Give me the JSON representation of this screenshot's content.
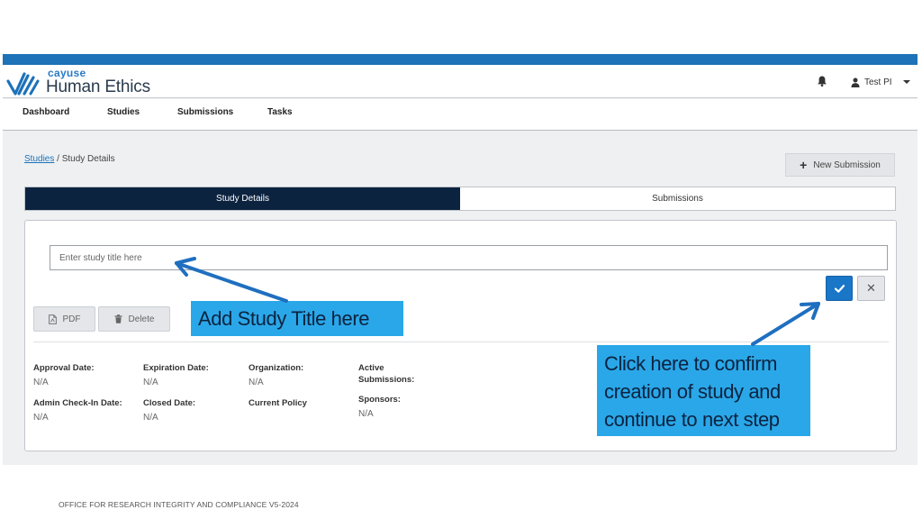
{
  "header": {
    "logo_small": "cayuse",
    "logo_big": "Human Ethics",
    "user_name": "Test PI",
    "icons": {
      "bell": "bell-icon",
      "user": "user-icon",
      "caret": "caret-down-icon"
    }
  },
  "nav": [
    "Dashboard",
    "Studies",
    "Submissions",
    "Tasks"
  ],
  "breadcrumb": {
    "link": "Studies",
    "separator": "/",
    "current": "Study Details"
  },
  "new_submission_label": "New Submission",
  "tabs": [
    {
      "label": "Study Details",
      "active": true
    },
    {
      "label": "Submissions",
      "active": false
    }
  ],
  "form": {
    "title_placeholder": "Enter study title here",
    "title_value": ""
  },
  "buttons": {
    "pdf": "PDF",
    "delete": "Delete",
    "confirm_icon": "check-icon",
    "cancel_icon": "close-icon"
  },
  "fields": {
    "approval_date": {
      "label": "Approval Date:",
      "value": "N/A"
    },
    "expiration_date": {
      "label": "Expiration Date:",
      "value": "N/A"
    },
    "organization": {
      "label": "Organization:",
      "value": "N/A"
    },
    "active_submissions": {
      "label_1": "Active",
      "label_2": "Submissions:"
    },
    "admin_checkin_date": {
      "label": "Admin Check-In Date:",
      "value": "N/A"
    },
    "closed_date": {
      "label": "Closed Date:",
      "value": "N/A"
    },
    "current_policy": {
      "label": "Current Policy"
    },
    "sponsors": {
      "label": "Sponsors:",
      "value": "N/A"
    }
  },
  "callouts": {
    "title": "Add Study Title here",
    "confirm_line1": "Click here to confirm",
    "confirm_line2": "creation of study and",
    "confirm_line3": "continue to next step"
  },
  "footer": "OFFICE FOR RESEARCH INTEGRITY AND COMPLIANCE V5-2024",
  "colors": {
    "brand_blue": "#1d72b8",
    "active_tab": "#0c2340",
    "confirm_button": "#1a76c7",
    "callout_bg": "#2aa7e8",
    "arrow": "#1f6fbf"
  }
}
